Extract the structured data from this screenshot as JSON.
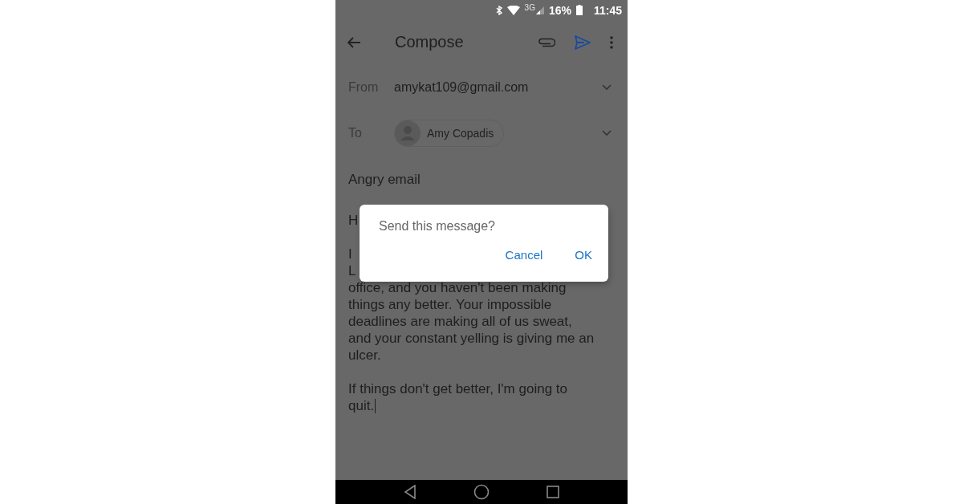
{
  "status_bar": {
    "network": "3G",
    "battery": "16%",
    "time": "11:45"
  },
  "toolbar": {
    "title": "Compose"
  },
  "from": {
    "label": "From",
    "value": "amykat109@gmail.com"
  },
  "to": {
    "label": "To",
    "recipients": [
      {
        "name": "Amy Copadis"
      }
    ]
  },
  "subject": "Angry email",
  "body": [
    [
      "H"
    ],
    [
      "I",
      "L",
      "office, and you haven't been making",
      "things any better. Your impossible",
      "deadlines are making all of us sweat,",
      "and your constant yelling is giving me an",
      "ulcer."
    ],
    [
      "If things don't get better, I'm going to",
      "quit."
    ]
  ],
  "dialog": {
    "message": "Send this message?",
    "buttons": [
      "Cancel",
      "OK"
    ]
  }
}
